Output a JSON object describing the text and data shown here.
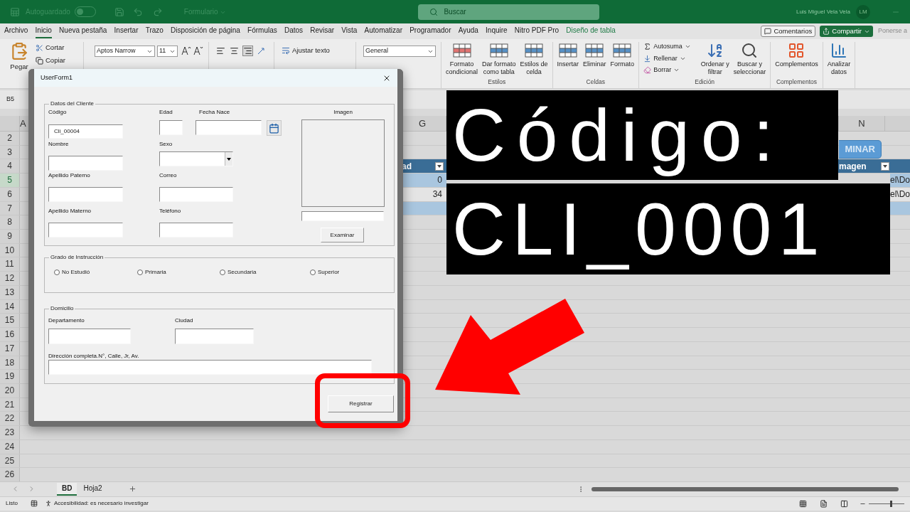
{
  "title_bar": {
    "autosave_label": "Autoguardado",
    "autosave_on": false,
    "file_name": "Formulario",
    "search_placeholder": "Buscar",
    "user_name": "Luis Miguel Vela Vela",
    "user_initials": "LM"
  },
  "menu_tabs": [
    {
      "label": "Archivo",
      "selected": false,
      "contextual": false
    },
    {
      "label": "Inicio",
      "selected": true,
      "contextual": false
    },
    {
      "label": "Nueva pestaña",
      "selected": false,
      "contextual": false
    },
    {
      "label": "Insertar",
      "selected": false,
      "contextual": false
    },
    {
      "label": "Trazo",
      "selected": false,
      "contextual": false
    },
    {
      "label": "Disposición de página",
      "selected": false,
      "contextual": false
    },
    {
      "label": "Fórmulas",
      "selected": false,
      "contextual": false
    },
    {
      "label": "Datos",
      "selected": false,
      "contextual": false
    },
    {
      "label": "Revisar",
      "selected": false,
      "contextual": false
    },
    {
      "label": "Vista",
      "selected": false,
      "contextual": false
    },
    {
      "label": "Automatizar",
      "selected": false,
      "contextual": false
    },
    {
      "label": "Programador",
      "selected": false,
      "contextual": false
    },
    {
      "label": "Ayuda",
      "selected": false,
      "contextual": false
    },
    {
      "label": "Inquire",
      "selected": false,
      "contextual": false
    },
    {
      "label": "Nitro PDF Pro",
      "selected": false,
      "contextual": false
    },
    {
      "label": "Diseño de tabla",
      "selected": false,
      "contextual": true
    }
  ],
  "header_buttons": {
    "comments": "Comentarios",
    "share": "Compartir",
    "coauthor": "Ponerse a"
  },
  "ribbon": {
    "paste": "Pegar",
    "cut": "Cortar",
    "copy": "Copiar",
    "font_name": "Aptos Narrow",
    "font_size": "11",
    "wrap_text": "Ajustar texto",
    "number_format": "General",
    "groups": [
      {
        "label": "Estilos",
        "commands": [
          "Formato\ncondicional",
          "Dar formato\ncomo tabla",
          "Estilos de\ncelda"
        ]
      },
      {
        "label": "Celdas",
        "commands": [
          "Insertar",
          "Eliminar",
          "Formato"
        ]
      },
      {
        "label": "Edición",
        "small_commands": [
          "Autosuma",
          "Rellenar",
          "Borrar"
        ],
        "commands": [
          "Ordenar y\nfiltrar",
          "Buscar y\nseleccionar"
        ]
      },
      {
        "label": "Complementos",
        "commands": [
          "Complementos"
        ]
      },
      {
        "commands": [
          "Analizar\ndatos"
        ]
      }
    ]
  },
  "name_box": "B5",
  "sheet": {
    "columns": [
      "A",
      "G",
      "N"
    ],
    "rows": [
      {
        "number": "2",
        "selected": false
      },
      {
        "number": "3",
        "selected": false,
        "button": "MINAR"
      },
      {
        "number": "4",
        "selected": false,
        "kind": "header",
        "column_g": "ad",
        "column_n": "magen"
      },
      {
        "number": "5",
        "selected": true,
        "kind": "band",
        "column_g": "0",
        "column_n": "el\\Do"
      },
      {
        "number": "6",
        "selected": false,
        "kind": "plain",
        "column_g": "34",
        "column_n": "el\\Do"
      },
      {
        "number": "7",
        "selected": false,
        "kind": "band"
      },
      {
        "number": "8",
        "selected": false
      },
      {
        "number": "9",
        "selected": false
      },
      {
        "number": "10",
        "selected": false
      },
      {
        "number": "11",
        "selected": false
      },
      {
        "number": "12",
        "selected": false
      },
      {
        "number": "13",
        "selected": false
      },
      {
        "number": "14",
        "selected": false
      },
      {
        "number": "15",
        "selected": false
      },
      {
        "number": "16",
        "selected": false
      },
      {
        "number": "17",
        "selected": false
      },
      {
        "number": "18",
        "selected": false
      },
      {
        "number": "19",
        "selected": false
      },
      {
        "number": "20",
        "selected": false
      },
      {
        "number": "21",
        "selected": false
      },
      {
        "number": "22",
        "selected": false
      },
      {
        "number": "23",
        "selected": false
      },
      {
        "number": "24",
        "selected": false
      },
      {
        "number": "25",
        "selected": false
      },
      {
        "number": "26",
        "selected": false
      }
    ]
  },
  "sheet_tabs": [
    {
      "label": "BD",
      "selected": true
    },
    {
      "label": "Hoja2",
      "selected": false
    }
  ],
  "status_bar": {
    "mode": "Listo",
    "accessibility": "Accesibilidad: es necesario investigar",
    "zoom": {
      "level": 0.6
    }
  },
  "form": {
    "title": "UserForm1",
    "client_frame": {
      "title": "Datos del Cliente",
      "fields": [
        {
          "kind": "text",
          "label": "Código",
          "value": "Cli_00004"
        },
        {
          "kind": "text",
          "label": "Edad"
        },
        {
          "kind": "date",
          "label": "Fecha Nace"
        },
        {
          "kind": "image",
          "label": "Imagen",
          "button": "Examinar"
        },
        {
          "kind": "text",
          "label": "Nombre"
        },
        {
          "kind": "combo",
          "label": "Sexo"
        },
        {
          "kind": "text",
          "label": "Apellido Paterno"
        },
        {
          "kind": "text",
          "label": "Correo"
        },
        {
          "kind": "text",
          "label": "Apellido Materno"
        },
        {
          "kind": "text",
          "label": "Teléfono"
        }
      ]
    },
    "education_frame": {
      "title": "Grado de Instrucción",
      "options": [
        {
          "label": "No Estudió",
          "selected": false
        },
        {
          "label": "Primaria",
          "selected": false
        },
        {
          "label": "Secundaria",
          "selected": false
        },
        {
          "label": "Superior",
          "selected": false
        }
      ]
    },
    "address_frame": {
      "title": "Domicilio",
      "fields": [
        {
          "label": "Departamento"
        },
        {
          "label": "Ciudad"
        },
        {
          "label": "Dirección completa.N°, Calle, Jr, Av."
        }
      ]
    },
    "submit_button": "Registrar"
  },
  "overlay": {
    "caption_lines": [
      "Código:",
      "CLI_0001"
    ]
  }
}
